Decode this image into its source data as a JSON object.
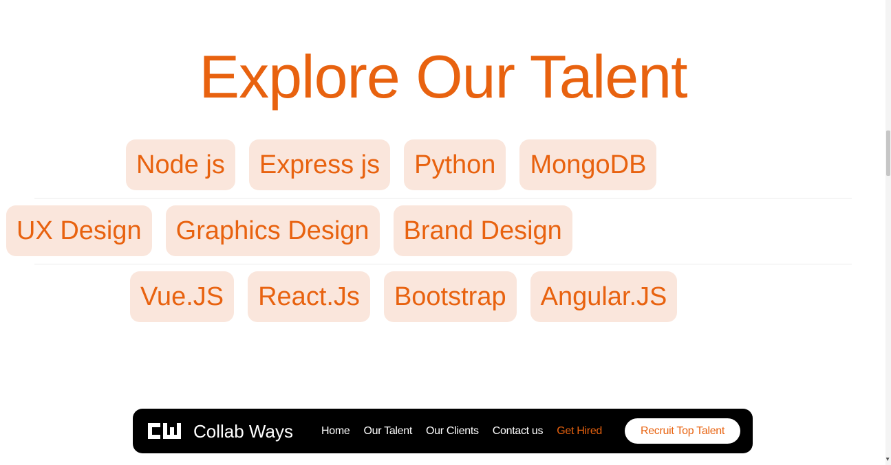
{
  "heading": "Explore Our Talent",
  "skill_rows": [
    [
      "Node js",
      "Express js",
      "Python",
      "MongoDB"
    ],
    [
      "UX Design",
      "Graphics Design",
      "Brand Design"
    ],
    [
      "Vue.JS",
      "React.Js",
      "Bootstrap",
      "Angular.JS"
    ]
  ],
  "navbar": {
    "logo_icon": "cw-logo-icon",
    "brand": "Collab Ways",
    "links": [
      "Home",
      "Our Talent",
      "Our Clients",
      "Contact us",
      "Get Hired"
    ],
    "cta": "Recruit Top Talent"
  },
  "colors": {
    "accent": "#e8620f",
    "chip_bg": "#fae6dc",
    "nav_bg": "#000000"
  }
}
